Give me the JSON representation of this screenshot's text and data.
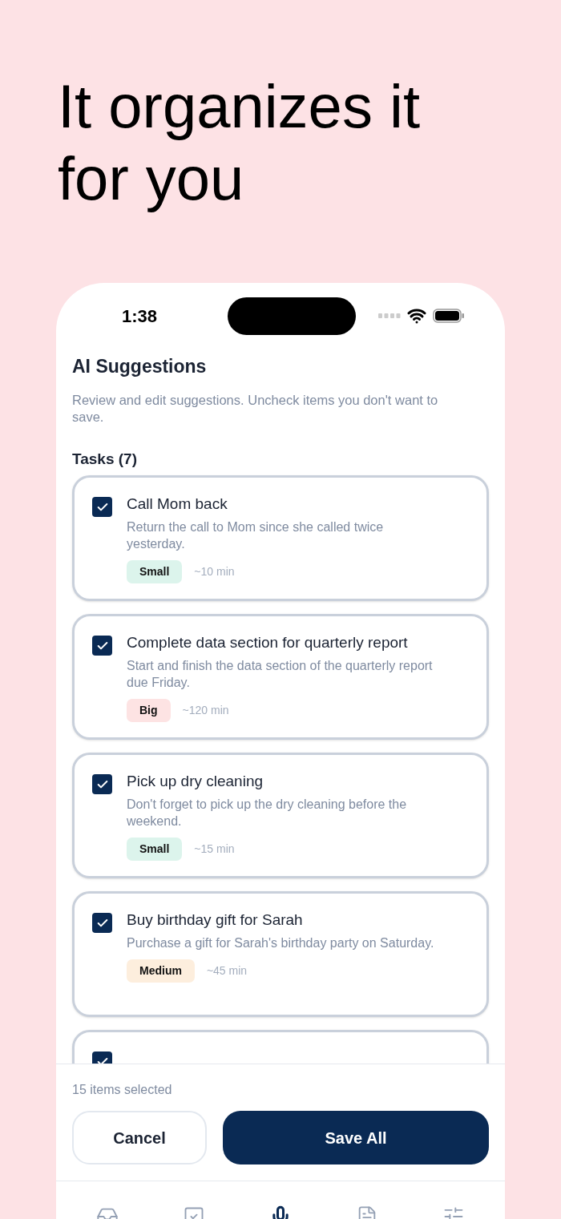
{
  "headline": "It organizes it for you",
  "status_bar": {
    "time": "1:38"
  },
  "screen": {
    "title": "AI Suggestions",
    "subtitle": "Review and edit suggestions. Uncheck items you don't want to save.",
    "section": "Tasks (7)"
  },
  "tasks": [
    {
      "checked": true,
      "title": "Call Mom back",
      "description": "Return the call to Mom since she called twice yesterday.",
      "size": "Small",
      "color": "#dcf4ec",
      "duration": "~10 min"
    },
    {
      "checked": true,
      "title": "Complete data section for quarterly report",
      "description": "Start and finish the data section of the quarterly report due Friday.",
      "size": "Big",
      "color": "#fde3e3",
      "duration": "~120 min"
    },
    {
      "checked": true,
      "title": "Pick up dry cleaning",
      "description": "Don't forget to pick up the dry cleaning before the weekend.",
      "size": "Small",
      "color": "#dcf4ec",
      "duration": "~15 min"
    },
    {
      "checked": true,
      "title": "Buy birthday gift for Sarah",
      "description": "Purchase a gift for Sarah's birthday party on Saturday.",
      "size": "Medium",
      "color": "#fdeedd",
      "duration": "~45 min"
    },
    {
      "checked": true
    }
  ],
  "footer": {
    "count": "15 items selected",
    "cancel": "Cancel",
    "save": "Save All"
  },
  "nav": [
    {
      "kind": "inbox",
      "selected": false
    },
    {
      "kind": "tasks",
      "selected": false
    },
    {
      "kind": "mic",
      "selected": true
    },
    {
      "kind": "notes",
      "selected": false
    },
    {
      "kind": "settings",
      "selected": false
    }
  ]
}
